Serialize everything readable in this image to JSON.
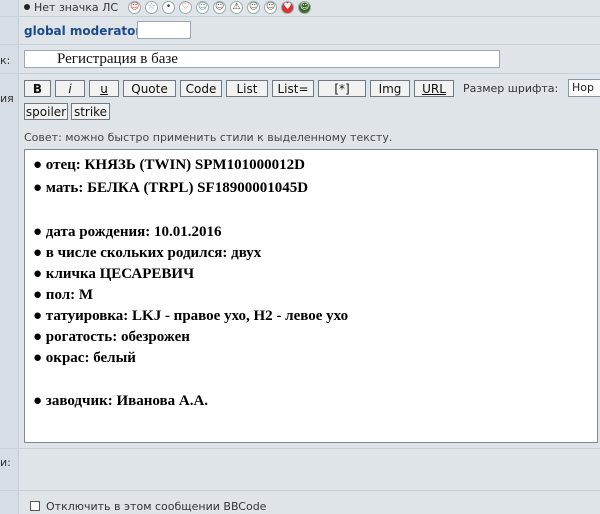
{
  "header": {
    "radio_label": "Нет значка ЛС",
    "moderator_label": "global moderator",
    "icons": [
      "smile-icon",
      "star-icon",
      "face-icon",
      "heart-icon",
      "face-icon",
      "face-icon",
      "warning-icon",
      "face-icon",
      "face-icon",
      "heart-icon",
      "face-icon"
    ]
  },
  "left_labels": {
    "subject_suffix": "к:",
    "message_suffix": "ия",
    "bottom_suffix": "и:"
  },
  "subject": {
    "value": "Регистрация в базе"
  },
  "toolbar": {
    "buttons": [
      "B",
      "i",
      "u",
      "Quote",
      "Code",
      "List",
      "List=",
      "[*]",
      "Img",
      "URL"
    ],
    "size_label": "Размер шрифта:",
    "size_value": "Нор",
    "buttons2": [
      "spoiler",
      "strike"
    ]
  },
  "hint": "Совет: можно быстро применить стили к выделенному тексту.",
  "editor": {
    "lines": [
      "● отец:  КНЯЗЬ (TWIN) SPM101000012D",
      "● мать:  БЕЛКА (TRPL) SF18900001045D",
      "",
      "● дата рождения: 10.01.2016",
      "● в числе скольких родился:  двух",
      "● кличка  ЦЕСАРЕВИЧ",
      "● пол:  М",
      "● татуировка: LKJ - правое ухо, H2 - левое ухо",
      "● рогатость: обезрожен",
      "● окрас:  белый",
      "",
      "● заводчик: Иванова А.А."
    ]
  },
  "options": {
    "disable_bbcode": "Отключить в этом сообщении BBCode"
  }
}
